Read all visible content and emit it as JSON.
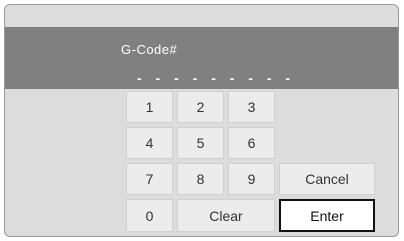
{
  "dialog": {
    "label": "G-Code#",
    "code_placeholder": "- - - - - - - - -"
  },
  "keypad": {
    "keys": [
      "1",
      "2",
      "3",
      "4",
      "5",
      "6",
      "7",
      "8",
      "9",
      "0"
    ],
    "clear": "Clear",
    "cancel": "Cancel",
    "enter": "Enter"
  },
  "colors": {
    "header": "#808080",
    "panel": "#dcdcdc",
    "key": "#ececec",
    "enter_border": "#111111"
  }
}
